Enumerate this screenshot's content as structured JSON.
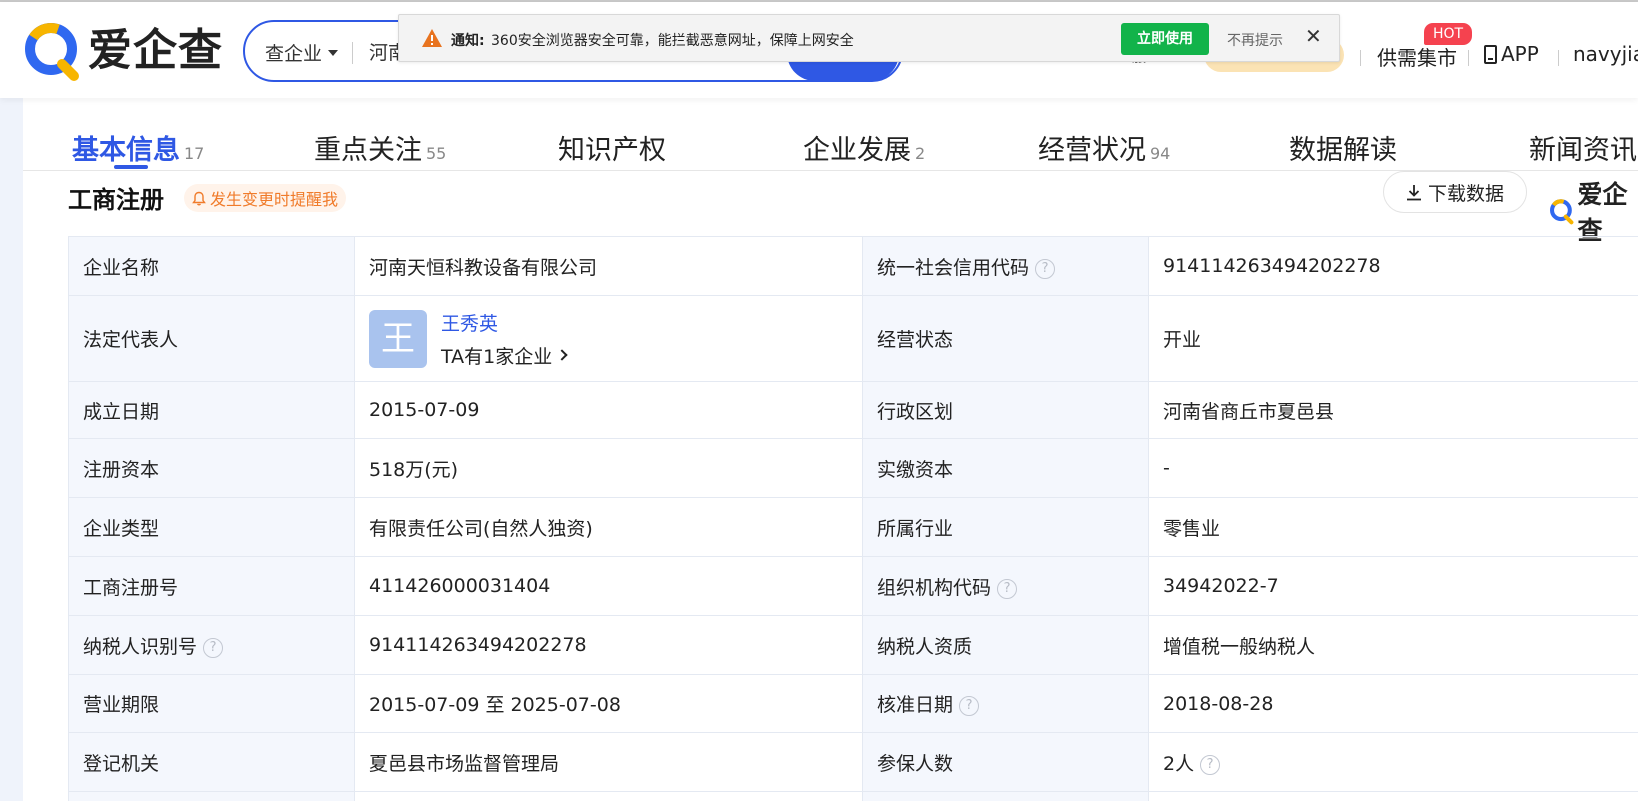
{
  "header": {
    "logo_text": "爱企查",
    "search_type": "查企业",
    "search_query": "河南",
    "partial_nav_text": "服",
    "nav_supply": "供需集市",
    "hot_badge": "HOT",
    "nav_app": "APP",
    "user_name": "navyjian"
  },
  "notice": {
    "title": "通知:",
    "text": "360安全浏览器安全可靠，能拦截恶意网址，保障上网安全",
    "use_button": "立即使用",
    "dismiss": "不再提示",
    "close": "✕"
  },
  "tabs": [
    {
      "label": "基本信息",
      "count": "17"
    },
    {
      "label": "重点关注",
      "count": "55"
    },
    {
      "label": "知识产权",
      "count": ""
    },
    {
      "label": "企业发展",
      "count": "2"
    },
    {
      "label": "经营状况",
      "count": "94"
    },
    {
      "label": "数据解读",
      "count": ""
    },
    {
      "label": "新闻资讯",
      "count": ""
    }
  ],
  "section": {
    "title": "工商注册",
    "remind": "发生变更时提醒我",
    "download": "下载数据",
    "brand": "爱企查"
  },
  "info": {
    "company_name": {
      "label": "企业名称",
      "value": "河南天恒科教设备有限公司"
    },
    "credit_code": {
      "label": "统一社会信用代码",
      "value": "914114263494202278"
    },
    "legal_rep": {
      "label": "法定代表人",
      "avatar": "王",
      "name": "王秀英",
      "sub": "TA有1家企业"
    },
    "status": {
      "label": "经营状态",
      "value": "开业"
    },
    "founded": {
      "label": "成立日期",
      "value": "2015-07-09"
    },
    "region": {
      "label": "行政区划",
      "value": "河南省商丘市夏邑县"
    },
    "reg_capital": {
      "label": "注册资本",
      "value": "518万(元)"
    },
    "paid_capital": {
      "label": "实缴资本",
      "value": "-"
    },
    "company_type": {
      "label": "企业类型",
      "value": "有限责任公司(自然人独资)"
    },
    "industry": {
      "label": "所属行业",
      "value": "零售业"
    },
    "reg_no": {
      "label": "工商注册号",
      "value": "411426000031404"
    },
    "org_code": {
      "label": "组织机构代码",
      "value": "34942022-7"
    },
    "tax_id": {
      "label": "纳税人识别号",
      "value": "914114263494202278"
    },
    "tax_qual": {
      "label": "纳税人资质",
      "value": "增值税一般纳税人"
    },
    "term": {
      "label": "营业期限",
      "value": "2015-07-09 至 2025-07-08"
    },
    "approved": {
      "label": "核准日期",
      "value": "2018-08-28"
    },
    "authority": {
      "label": "登记机关",
      "value": "夏邑县市场监督管理局"
    },
    "insured": {
      "label": "参保人数",
      "value": "2人"
    }
  },
  "colors": {
    "brand_blue": "#2f58e4",
    "notice_green": "#12b34a",
    "hot_red": "#f5424f",
    "remind_orange": "#f07b2a",
    "label_bg": "#f4f7fd"
  },
  "icons": [
    "aiqicha-logo-icon",
    "caret-down-icon",
    "warning-icon",
    "close-icon",
    "phone-icon",
    "bell-icon",
    "download-icon",
    "question-icon",
    "chevron-right-icon"
  ]
}
